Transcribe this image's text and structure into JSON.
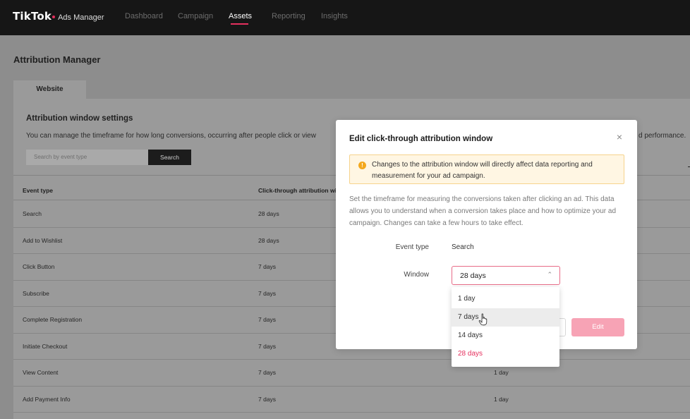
{
  "brand": {
    "name": "TikTok",
    "sub": "Ads Manager",
    "accent": "#e5305e"
  },
  "nav": [
    "Dashboard",
    "Campaign",
    "Assets",
    "Reporting",
    "Insights"
  ],
  "nav_active": "Assets",
  "page": {
    "title": "Attribution Manager",
    "tab": "Website",
    "section_title": "Attribution window settings",
    "section_desc": "You can manage the timeframe for how long conversions, occurring after people click or view",
    "section_desc_tail": "d performance.",
    "search_placeholder": "Search by event type",
    "search_button": "Search"
  },
  "table": {
    "headers": [
      "Event type",
      "Click-through attribution wi"
    ],
    "rows": [
      {
        "event": "Search",
        "click": "28 days",
        "view": ""
      },
      {
        "event": "Add to Wishlist",
        "click": "28 days",
        "view": ""
      },
      {
        "event": "Click Button",
        "click": "7 days",
        "view": ""
      },
      {
        "event": "Subscribe",
        "click": "7 days",
        "view": ""
      },
      {
        "event": "Complete Registration",
        "click": "7 days",
        "view": ""
      },
      {
        "event": "Initiate Checkout",
        "click": "7 days",
        "view": ""
      },
      {
        "event": "View Content",
        "click": "7 days",
        "view": "1 day"
      },
      {
        "event": "Add Payment Info",
        "click": "7 days",
        "view": "1 day"
      }
    ]
  },
  "modal": {
    "title": "Edit click-through attribution window",
    "close": "×",
    "alert": "Changes to the attribution window will directly affect data reporting and measurement for your ad campaign.",
    "alert_icon": "!",
    "description": "Set the timeframe for measuring the conversions taken after clicking an ad. This data allows you to understand when a conversion takes place and how to optimize your ad campaign. Changes can take a few hours to take effect.",
    "event_type_label": "Event type",
    "event_type_value": "Search",
    "window_label": "Window",
    "window_value": "28 days",
    "edit_button": "Edit"
  },
  "dropdown": {
    "options": [
      "1 day",
      "7 days",
      "14 days",
      "28 days"
    ],
    "hovered": "7 days",
    "selected": "28 days"
  }
}
